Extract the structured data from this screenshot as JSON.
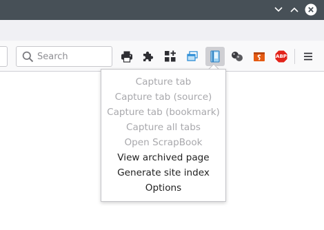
{
  "window": {
    "minimize_icon": "chevron-down-icon",
    "maximize_icon": "chevron-up-icon",
    "close_icon": "close-icon"
  },
  "search": {
    "placeholder": "Search",
    "icon": "search-icon"
  },
  "toolbar": {
    "buttons": [
      {
        "name": "print-icon"
      },
      {
        "name": "puzzle-icon"
      },
      {
        "name": "add-widget-icon"
      },
      {
        "name": "tabs-icon"
      },
      {
        "name": "scrapbook-icon",
        "active": true
      },
      {
        "name": "extension-icon"
      },
      {
        "name": "slides-icon"
      },
      {
        "name": "adblock-icon",
        "label": "ABP"
      },
      {
        "name": "hamburger-menu-icon"
      }
    ]
  },
  "menu": {
    "items": [
      {
        "label": "Capture tab",
        "enabled": false
      },
      {
        "label": "Capture tab (source)",
        "enabled": false
      },
      {
        "label": "Capture tab (bookmark)",
        "enabled": false
      },
      {
        "label": "Capture all tabs",
        "enabled": false
      },
      {
        "label": "Open ScrapBook",
        "enabled": false
      },
      {
        "label": "View archived page",
        "enabled": true
      },
      {
        "label": "Generate site index",
        "enabled": true
      },
      {
        "label": "Options",
        "enabled": true
      }
    ]
  },
  "colors": {
    "titlebar": "#475057",
    "disabled_text": "#a8a8ac",
    "enabled_text": "#1e1e1e",
    "adblock_red": "#e2231a",
    "slides_orange": "#e55a12",
    "tabs_blue": "#2c8dd6"
  }
}
